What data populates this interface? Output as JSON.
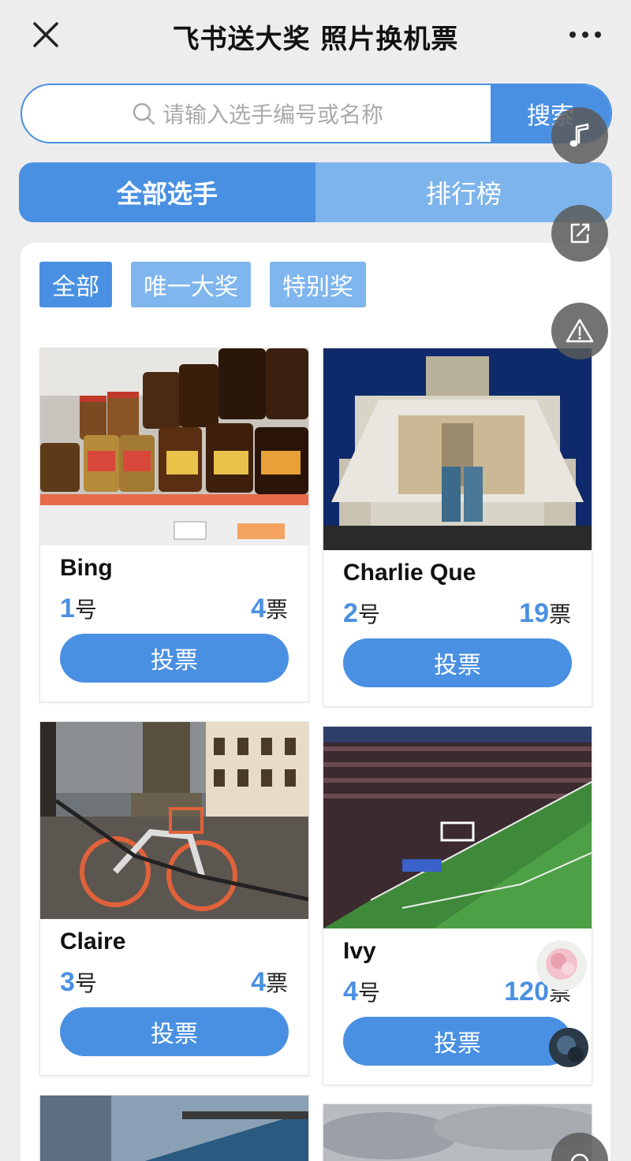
{
  "header": {
    "title": "飞书送大奖 照片换机票"
  },
  "search": {
    "placeholder": "请输入选手编号或名称",
    "button_label": "搜索"
  },
  "tabs": [
    {
      "label": "全部选手",
      "active": true
    },
    {
      "label": "排行榜",
      "active": false
    }
  ],
  "filters": [
    {
      "label": "全部",
      "active": true
    },
    {
      "label": "唯一大奖",
      "active": false
    },
    {
      "label": "特别奖",
      "active": false
    }
  ],
  "contestants": [
    {
      "name": "Bing",
      "number": "1",
      "number_suffix": "号",
      "votes": "4",
      "votes_suffix": "票",
      "vote_label": "投票"
    },
    {
      "name": "Charlie Que",
      "number": "2",
      "number_suffix": "号",
      "votes": "19",
      "votes_suffix": "票",
      "vote_label": "投票"
    },
    {
      "name": "Claire",
      "number": "3",
      "number_suffix": "号",
      "votes": "4",
      "votes_suffix": "票",
      "vote_label": "投票"
    },
    {
      "name": "Ivy",
      "number": "4",
      "number_suffix": "号",
      "votes": "120",
      "votes_suffix": "票",
      "vote_label": "投票"
    }
  ],
  "colors": {
    "accent": "#4a90e2",
    "accent_light": "#7eb4ec",
    "background": "#ededed"
  },
  "icons": {
    "close": "close-icon",
    "more": "more-icon",
    "search": "search-icon",
    "music": "music-note-icon",
    "share": "share-icon",
    "report": "warning-icon"
  }
}
